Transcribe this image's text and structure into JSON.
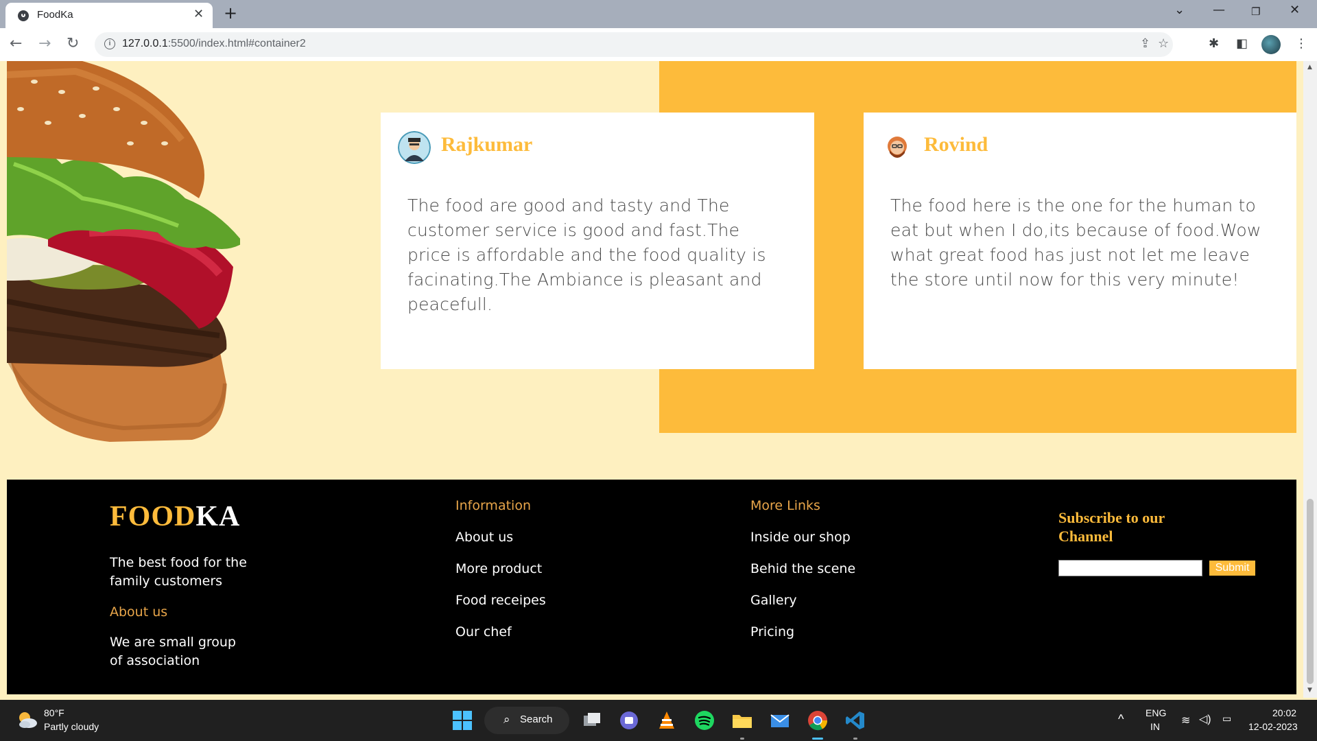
{
  "browser": {
    "tab_title": "FoodKa",
    "tab_close": "✕",
    "new_tab": "+",
    "url_host": "127.0.0.1",
    "url_rest": ":5500/index.html#container2"
  },
  "testimonials": [
    {
      "name": "Rajkumar",
      "text": "The food are good and tasty and The customer service is good and fast.The price is affordable and the food quality is facinating.The Ambiance is pleasant and peacefull."
    },
    {
      "name": "Rovind",
      "text": "The food here is the one for the human to eat but when I do,its because of food.Wow what great food has just not let me leave the store until now for this very minute!"
    }
  ],
  "footer": {
    "brand_part1": "FOOD",
    "brand_part2": "KA",
    "tagline": "The best food for the family customers",
    "about_heading": "About us",
    "about_text": "We are small group of association",
    "info": {
      "heading": "Information",
      "links": [
        "About us",
        "More product",
        "Food receipes",
        "Our chef"
      ]
    },
    "more": {
      "heading": "More Links",
      "links": [
        "Inside our shop",
        "Behid the scene",
        "Gallery",
        "Pricing"
      ]
    },
    "subscribe": {
      "title": "Subscribe to our Channel",
      "input_value": "",
      "button": "Submit"
    }
  },
  "taskbar": {
    "weather_temp": "80°F",
    "weather_condition": "Partly cloudy",
    "search_label": "Search",
    "lang_line1": "ENG",
    "lang_line2": "IN",
    "time": "20:02",
    "date": "12-02-2023"
  },
  "colors": {
    "accent": "#fdbb3b",
    "page_bg": "#fef0c0",
    "footer_bg": "#000000"
  }
}
